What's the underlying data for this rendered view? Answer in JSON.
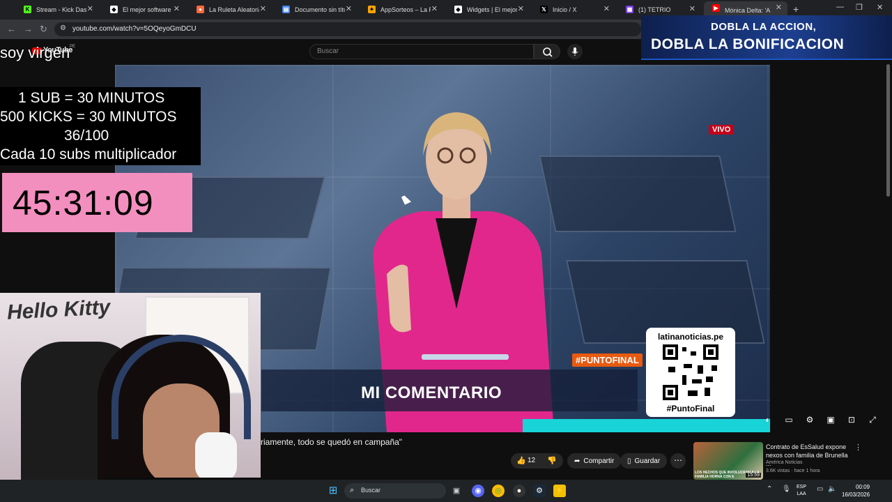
{
  "browser": {
    "tabs": [
      {
        "title": "Stream - Kick Dashbo",
        "favicon": "kick-icon",
        "color": "#53fc18",
        "glyph": "K",
        "active": false
      },
      {
        "title": "El mejor software par",
        "favicon": "streamelements-icon",
        "color": "#ffffff",
        "glyph": "◆",
        "active": false
      },
      {
        "title": "La Ruleta Aleatoria",
        "favicon": "wheel-icon",
        "color": "#ff6a3d",
        "glyph": "●",
        "active": false
      },
      {
        "title": "Documento sin título",
        "favicon": "google-docs-icon",
        "color": "#4285f4",
        "glyph": "▤",
        "active": false
      },
      {
        "title": "AppSorteos – La Rule",
        "favicon": "appsorteos-icon",
        "color": "#f6a400",
        "glyph": "✦",
        "active": false
      },
      {
        "title": "Widgets | El mejor so",
        "favicon": "streamelements-icon",
        "color": "#ffffff",
        "glyph": "◆",
        "active": false
      },
      {
        "title": "Inicio / X",
        "favicon": "x-icon",
        "color": "#000000",
        "glyph": "𝕏",
        "active": false
      },
      {
        "title": "(1) TETRIO",
        "favicon": "tetrio-icon",
        "color": "#7b3fe4",
        "glyph": "▦",
        "active": false
      },
      {
        "title": "Mónica Delta: 'A",
        "favicon": "youtube-icon",
        "color": "#ff0000",
        "glyph": "▶",
        "active": true
      }
    ],
    "url": "youtube.com/watch?v=5OQeyoGmDCU"
  },
  "youtube": {
    "brand": "YouTube",
    "region": "PE",
    "search_placeholder": "Buscar",
    "video": {
      "live_badge": "VIVO",
      "hashtag": "#PUNTOFINAL",
      "lower_third": "MI COMENTARIO",
      "qr_site": "latinanoticias.pe",
      "qr_tag": "#PuntoFinal"
    },
    "title_fragment": "riamente, todo se quedó en campaña\"",
    "likes": "12",
    "share_label": "Compartir",
    "save_label": "Guardar",
    "suggested": {
      "title": "Contrato de EsSalud expone nexos con familia de Brunella ...",
      "channel": "América Noticias",
      "meta": "3.6K vistas · hace 1 hora",
      "thumb_caption": "LOS HECHOS QUE INVOLUCRAN A LA FAMILIA HORNA CON E",
      "duration": "15:59"
    }
  },
  "overlays": {
    "stream_title": "soy virgen",
    "promo_line1": "DOBLA LA ACCION,",
    "promo_line2": "DOBLA LA BONIFICACION",
    "sub_rules": [
      "1 SUB     = 30 MINUTOS",
      "500 KICKS = 30 MINUTOS",
      "36/100",
      "Cada 10 subs multiplicador"
    ],
    "timer": "45:31:09",
    "webcam_decor_text": "Hello Kitty"
  },
  "taskbar": {
    "search_label": "Buscar",
    "lang": "ESP",
    "layout": "LAA",
    "time": "00:09",
    "date": "16/03/2026"
  },
  "colors": {
    "accent_red": "#ff0000",
    "timer_pink": "#f28fbf",
    "vivo_red": "#c4001a",
    "hashtag_orange": "#e85a10",
    "cyan_band": "#18d4d8"
  }
}
